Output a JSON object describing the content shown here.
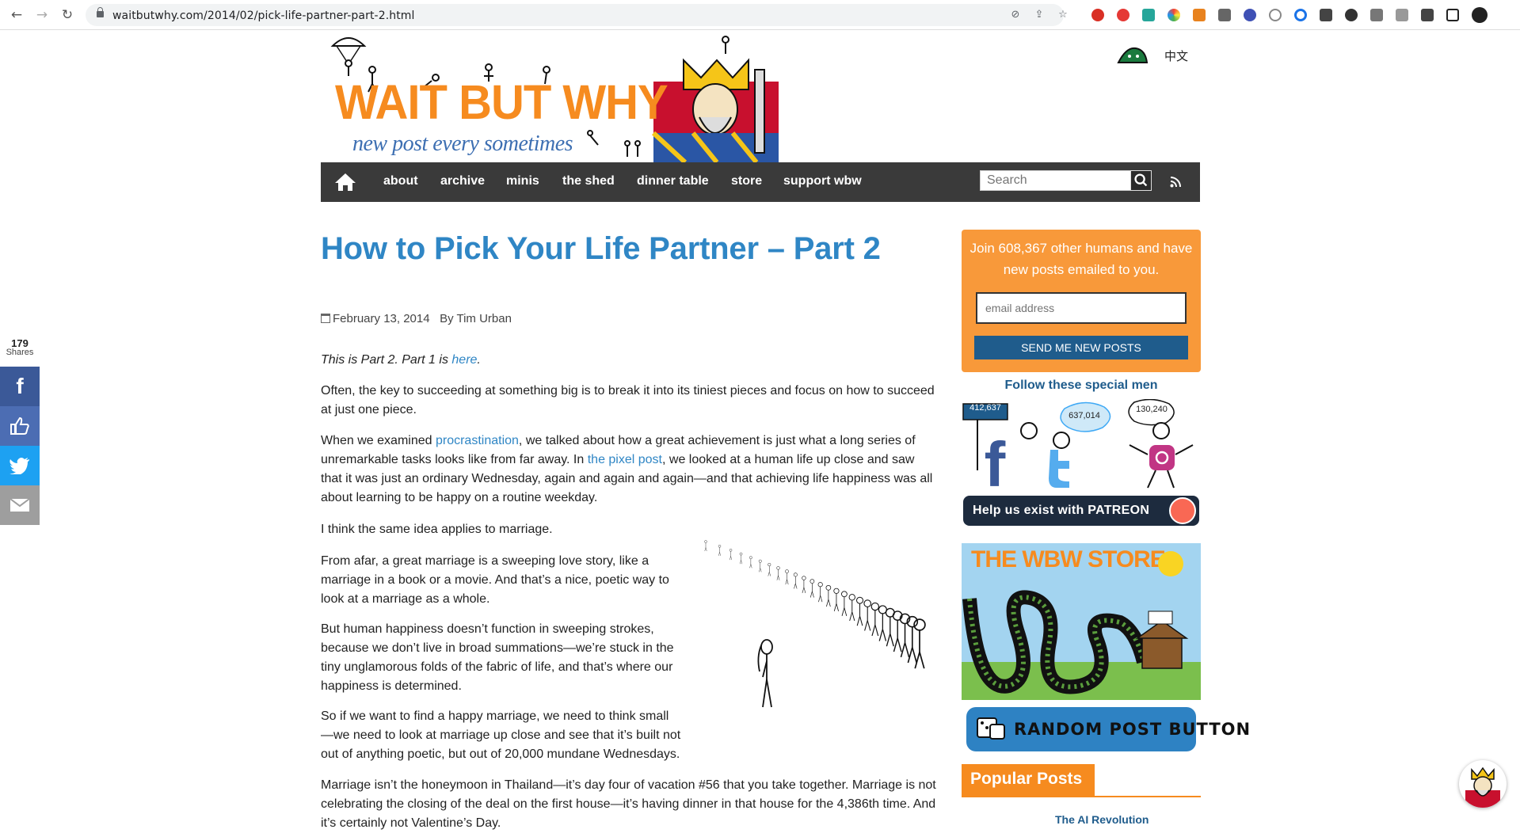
{
  "browser": {
    "url": "waitbutwhy.com/2014/02/pick-life-partner-part-2.html"
  },
  "site": {
    "logo_text": "WAIT BUT WHY",
    "tagline": "new post every sometimes",
    "language_link": "中文"
  },
  "nav": {
    "items": [
      "about",
      "archive",
      "minis",
      "the shed",
      "dinner table",
      "store",
      "support wbw"
    ],
    "search_placeholder": "Search"
  },
  "post": {
    "title": "How to Pick Your Life Partner – Part 2",
    "date": "February 13, 2014",
    "author": "By Tim Urban",
    "intro_prefix": "This is Part 2. Part 1 is ",
    "intro_link": "here",
    "intro_suffix": ".",
    "p1": "Often, the key to succeeding at something big is to break it into its tiniest pieces and focus on how to succeed at just one piece.",
    "p2_a": "When we examined ",
    "p2_link1": "procrastination",
    "p2_b": ", we talked about how a great achievement is just what a long series of unremarkable tasks looks like from far away. In ",
    "p2_link2": "the pixel post",
    "p2_c": ", we looked at a human life up close and saw that it was just an ordinary Wednesday, again and again and again—and that achieving life happiness was all about learning to be happy on a routine weekday.",
    "p3": "I think the same idea applies to marriage.",
    "p4": "From afar, a great marriage is a sweeping love story, like a marriage in a book or a movie. And that’s a nice, poetic way to look at a marriage as a whole.",
    "p5": "But human happiness doesn’t function in sweeping strokes, because we don’t live in broad summations—we’re stuck in the tiny unglamorous folds of the fabric of life, and that’s where our happiness is determined.",
    "p6": "So if we want to find a happy marriage, we need to think small—we need to look at marriage up close and see that it’s built not out of anything poetic, but out of 20,000 mundane Wednesdays.",
    "p7": "Marriage isn’t the honeymoon in Thailand—it’s day four of vacation #56 that you take together. Marriage is not celebrating the closing of the deal on the first house—it’s having dinner in that house for the 4,386th time. And it’s certainly not Valentine’s Day."
  },
  "share": {
    "count": "179",
    "label": "Shares"
  },
  "sidebar": {
    "subscribe_text": "Join 608,367 other humans and have new posts emailed to you.",
    "email_placeholder": "email address",
    "subscribe_button": "SEND ME NEW POSTS",
    "follow_title": "Follow these special men",
    "facebook_count": "412,637",
    "twitter_count": "637,014",
    "instagram_count": "130,240",
    "patreon_text": "Help us exist with PATREON",
    "store_title": "THE WBW STORE",
    "random_button": "RANDOM POST BUTTON",
    "popular_title": "Popular Posts",
    "popular_first": "The AI Revolution"
  },
  "colors": {
    "accent_orange": "#f68b1f",
    "link_blue": "#2f86c5",
    "nav_dark": "#3a3a3a",
    "facebook": "#3b5998",
    "twitter": "#1da1f2"
  }
}
